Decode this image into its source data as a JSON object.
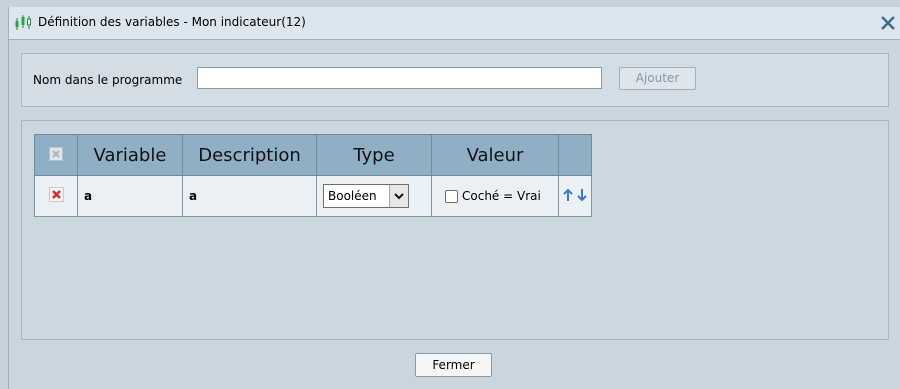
{
  "window": {
    "title": "Définition des variables - Mon indicateur(12)",
    "app_icon": "candlestick-chart-icon",
    "close_icon": "close-icon"
  },
  "name_section": {
    "label": "Nom dans le programme",
    "input_value": "",
    "add_button": "Ajouter"
  },
  "table": {
    "headers": {
      "delete": "delete-all-icon",
      "variable": "Variable",
      "description": "Description",
      "type": "Type",
      "value": "Valeur",
      "move": ""
    },
    "rows": [
      {
        "delete_icon": "delete-icon",
        "variable": "a",
        "description": "a",
        "type": "Booléen",
        "value_checked": false,
        "value_label": "Coché = Vrai",
        "move_icons": [
          "arrow-up-icon",
          "arrow-down-icon"
        ]
      }
    ]
  },
  "footer": {
    "close_button": "Fermer"
  },
  "colors": {
    "accent_blue": "#3a78c9",
    "delete_red": "#d03030",
    "header_bg": "#8fb0c4"
  }
}
